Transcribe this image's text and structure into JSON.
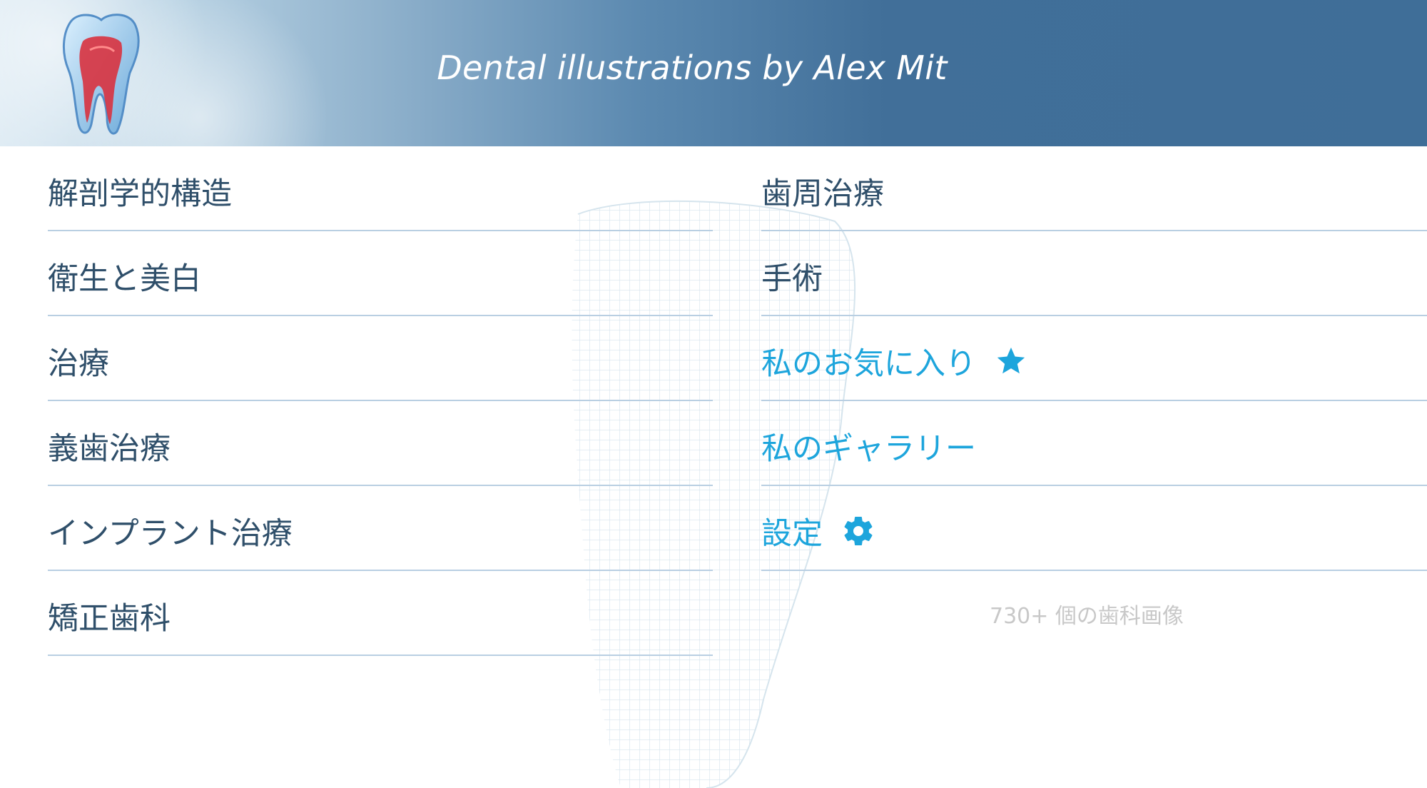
{
  "header": {
    "title": "Dental illustrations by Alex Mit"
  },
  "menu": {
    "left": [
      {
        "label": "解剖学的構造"
      },
      {
        "label": "衛生と美白"
      },
      {
        "label": "治療"
      },
      {
        "label": "義歯治療"
      },
      {
        "label": "インプラント治療"
      },
      {
        "label": "矯正歯科"
      }
    ],
    "right": [
      {
        "label": "歯周治療"
      },
      {
        "label": "手術"
      },
      {
        "label": "私のお気に入り",
        "icon": "star-icon"
      },
      {
        "label": "私のギャラリー"
      },
      {
        "label": "設定",
        "icon": "gear-icon"
      }
    ]
  },
  "footer": {
    "caption": "730+ 個の歯科画像"
  },
  "colors": {
    "accent": "#1da5dc",
    "text": "#2f4f6a",
    "header": "#3f6e98"
  }
}
